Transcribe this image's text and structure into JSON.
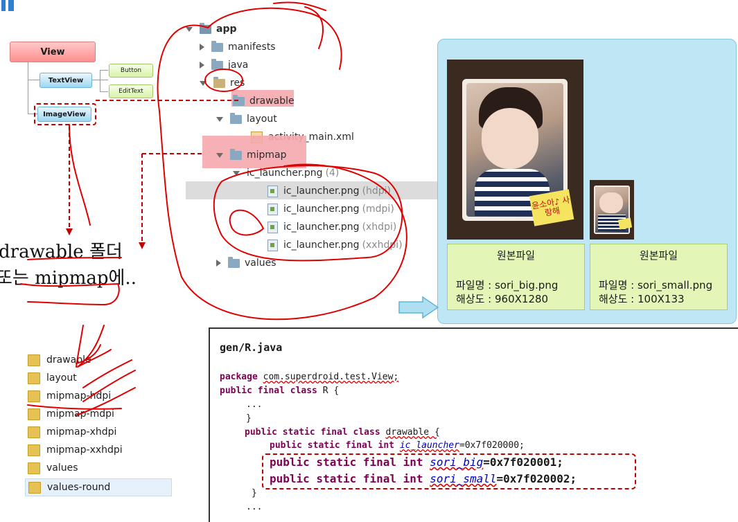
{
  "hierarchy": {
    "root": "View",
    "children": [
      "TextView",
      "ImageView"
    ],
    "textview_children": [
      "Button",
      "EditText"
    ]
  },
  "project_tree": {
    "app": "app",
    "manifests": "manifests",
    "java": "java",
    "res": "res",
    "drawable": "drawable",
    "layout": "layout",
    "activity_main": "activity_main.xml",
    "mipmap": "mipmap",
    "ic_group": "ic_launcher.png",
    "ic_group_count": "(4)",
    "icons": [
      {
        "name": "ic_launcher.png",
        "density": "(hdpi)"
      },
      {
        "name": "ic_launcher.png",
        "density": "(mdpi)"
      },
      {
        "name": "ic_launcher.png",
        "density": "(xhdpi)"
      },
      {
        "name": "ic_launcher.png",
        "density": "(xxhdpi)"
      }
    ],
    "values": "values"
  },
  "caption_text": {
    "line1": "drawable 폴더",
    "line2": "또는 mipmap에.."
  },
  "explorer_folders": [
    "drawable",
    "layout",
    "mipmap-hdpi",
    "mipmap-mdpi",
    "mipmap-xhdpi",
    "mipmap-xxhdpi",
    "values",
    "values-round"
  ],
  "images": [
    {
      "title": "원본파일",
      "filename_line": "파일명 : sori_big.png",
      "resolution_line": "해상도 : 960X1280",
      "note": "윤소아♪ 사랑해"
    },
    {
      "title": "원본파일",
      "filename_line": "파일명 : sori_small.png",
      "resolution_line": "해상도 : 100X133"
    }
  ],
  "code": {
    "title": "gen/R.java",
    "lines": {
      "pkg_kw": "package",
      "pkg_name": "com.superdroid.test.View;",
      "cls_kw": "public final class",
      "cls_name": "R {",
      "ellipsis1": "...",
      "close1": "}",
      "inner_kw": "public static final class",
      "inner_name": "drawable {",
      "l1_kw": "public static final int",
      "l1_name": "ic_launcher",
      "l1_val": "=0x7f020000;",
      "l2_kw": "public static final int",
      "l2_name": "sori_big",
      "l2_val": "=0x7f020001;",
      "l3_kw": "public static final int",
      "l3_name": "sori_small",
      "l3_val": "=0x7f020002;",
      "close2": "}",
      "ellipsis2": "..."
    }
  },
  "colors": {
    "annotation_red": "#e00000",
    "panel_blue": "#bfe6f5",
    "caption_green": "#e3f6b8",
    "highlight_pink": "#f5a9ae"
  }
}
